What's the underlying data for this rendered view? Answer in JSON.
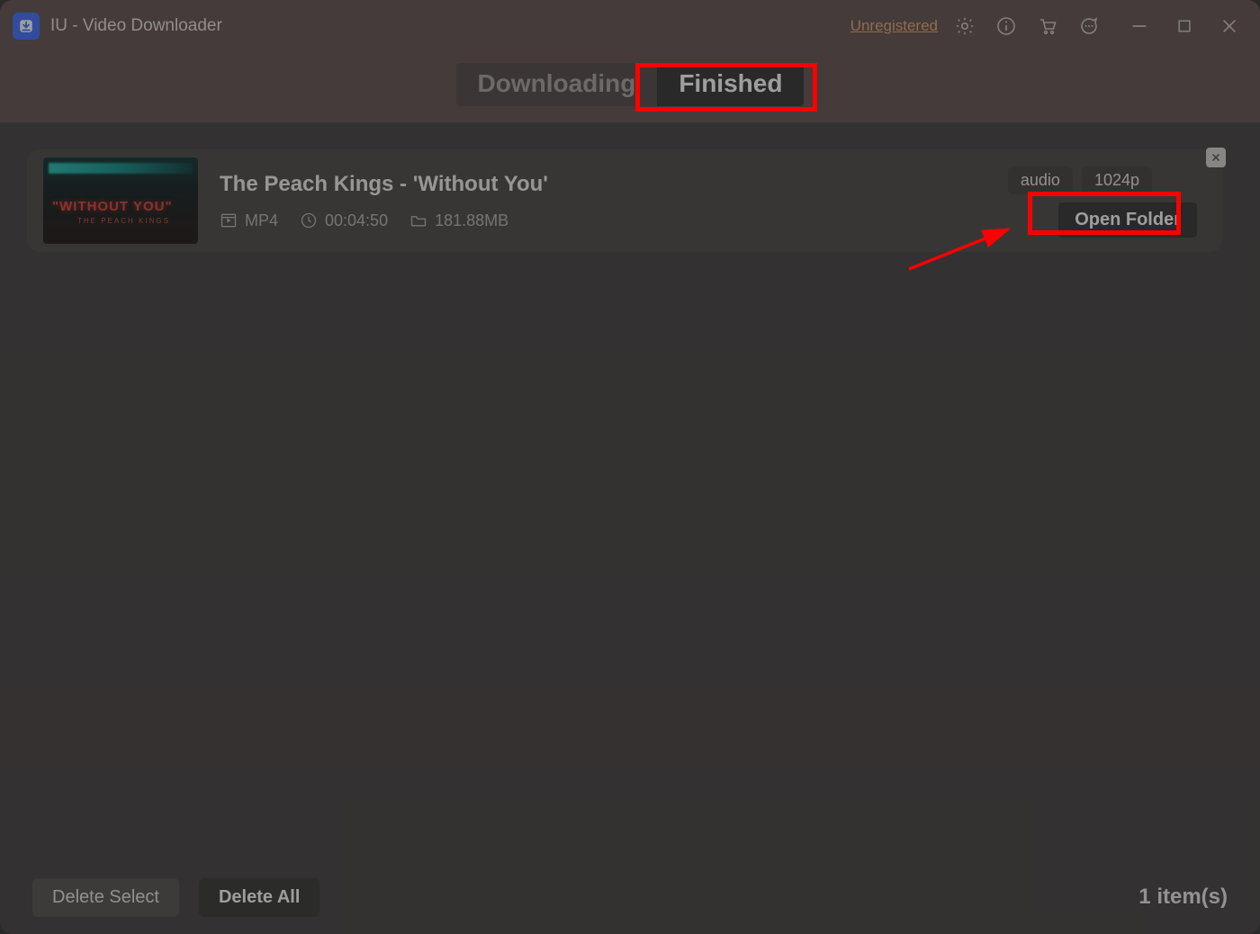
{
  "titlebar": {
    "app_title": "IU - Video Downloader",
    "unregistered_label": "Unregistered"
  },
  "tabs": {
    "downloading_label": "Downloading",
    "finished_label": "Finished",
    "active": "finished"
  },
  "item": {
    "title": "The Peach Kings - 'Without You'",
    "format": "MP4",
    "duration": "00:04:50",
    "size": "181.88MB",
    "badge_audio": "audio",
    "badge_quality": "1024p",
    "open_folder_label": "Open Folder",
    "thumb_main_text": "\"WITHOUT YOU\"",
    "thumb_sub_text": "THE PEACH KINGS"
  },
  "bottombar": {
    "delete_select_label": "Delete Select",
    "delete_all_label": "Delete All",
    "count_label": "1 item(s)"
  }
}
